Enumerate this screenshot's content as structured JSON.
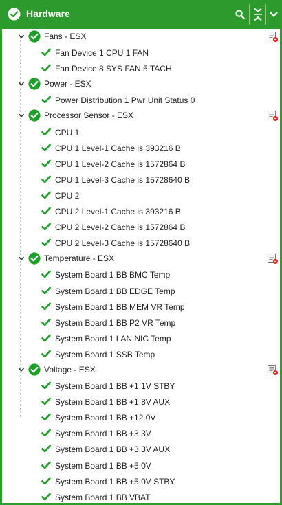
{
  "header": {
    "title": "Hardware",
    "bg_color": "#2c9a2c",
    "status_icon": "check-circle-icon",
    "buttons": [
      "search-icon",
      "collapse-all-icon",
      "chevron-down-icon"
    ]
  },
  "groups": [
    {
      "label": "Fans - ESX",
      "has_report_icon": true,
      "items": [
        "Fan Device 1 CPU 1 FAN",
        "Fan Device 8 SYS FAN 5 TACH"
      ]
    },
    {
      "label": "Power - ESX",
      "has_report_icon": false,
      "items": [
        "Power Distribution 1 Pwr Unit Status 0"
      ]
    },
    {
      "label": "Processor Sensor - ESX",
      "has_report_icon": true,
      "items": [
        "CPU 1",
        "CPU 1 Level-1 Cache is 393216 B",
        "CPU 1 Level-2 Cache is 1572864 B",
        "CPU 1 Level-3 Cache is 15728640 B",
        "CPU 2",
        "CPU 2 Level-1 Cache is 393216 B",
        "CPU 2 Level-2 Cache is 1572864 B",
        "CPU 2 Level-3 Cache is 15728640 B"
      ]
    },
    {
      "label": "Temperature - ESX",
      "has_report_icon": true,
      "items": [
        "System Board 1 BB BMC Temp",
        "System Board 1 BB EDGE Temp",
        "System Board 1 BB MEM VR Temp",
        "System Board 1 BB P2 VR Temp",
        "System Board 1 LAN NIC Temp",
        "System Board 1 SSB Temp"
      ]
    },
    {
      "label": "Voltage - ESX",
      "has_report_icon": true,
      "items": [
        "System Board 1 BB +1.1V STBY",
        "System Board 1 BB +1.8V AUX",
        "System Board 1 BB +12.0V",
        "System Board 1 BB +3.3V",
        "System Board 1 BB +3.3V AUX",
        "System Board 1 BB +5.0V",
        "System Board 1 BB +5.0V STBY",
        "System Board 1 BB VBAT"
      ]
    }
  ],
  "colors": {
    "ok_green": "#1f9e2a",
    "border_green": "#2e9b2e"
  }
}
